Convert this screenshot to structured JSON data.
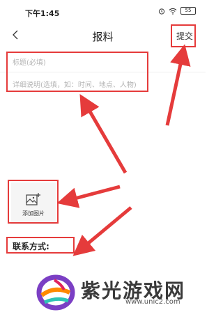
{
  "status_bar": {
    "time": "下午1:45",
    "battery": "55"
  },
  "nav": {
    "title": "报料",
    "submit_label": "提交"
  },
  "form": {
    "title_placeholder": "标题(必填)",
    "detail_placeholder": "详细说明(选填，如：时间、地点、人物)",
    "add_photo_label": "添加图片",
    "contact_label": "联系方式:"
  },
  "watermark": {
    "name": "紫光游戏网",
    "url": "www.unic2.com"
  },
  "colors": {
    "annotation": "#e53b3b",
    "placeholder": "#b4b4b4"
  }
}
